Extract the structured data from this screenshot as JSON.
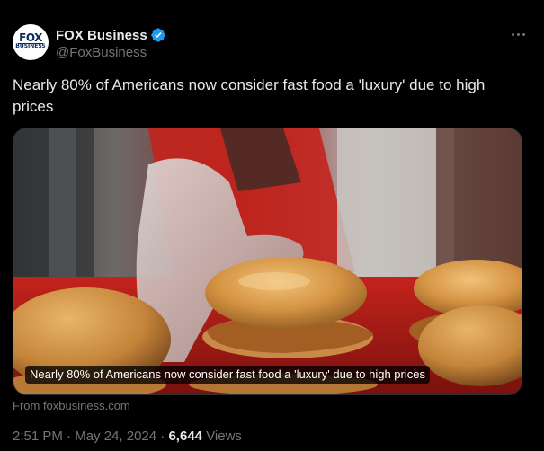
{
  "author": {
    "display_name": "FOX Business",
    "handle": "@FoxBusiness",
    "avatar_logo": "FOX",
    "avatar_sub": "BUSINESS",
    "verified": true
  },
  "tweet": {
    "text": "Nearly 80% of Americans now consider fast food a 'luxury' due to high prices"
  },
  "media": {
    "caption": "Nearly 80% of Americans now consider fast food a 'luxury' due to high prices",
    "source": "From foxbusiness.com"
  },
  "meta": {
    "time": "2:51 PM",
    "separator": "·",
    "date": "May 24, 2024",
    "views_count": "6,644",
    "views_label": "Views"
  },
  "icons": {
    "verified": "verified-badge-icon",
    "more": "more-options-icon"
  },
  "colors": {
    "background": "#000000",
    "text_primary": "#e7e9ea",
    "text_secondary": "#71767b",
    "verified_blue": "#1d9bf0",
    "border": "#2f3336"
  }
}
